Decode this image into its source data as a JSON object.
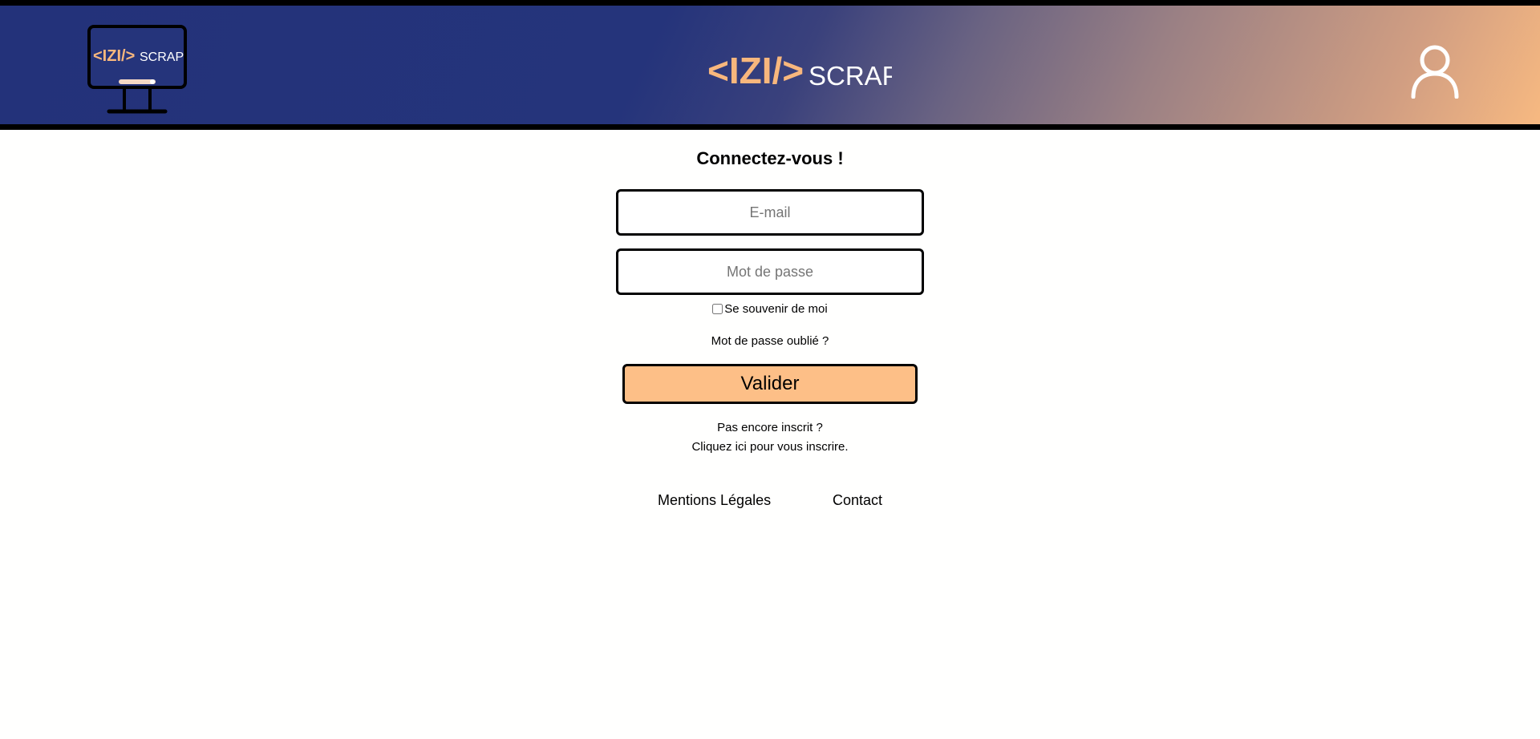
{
  "header": {
    "logo_small": {
      "brackets": "<IZI/>",
      "brand": "SCRAP"
    },
    "logo_center": {
      "brackets": "<IZI/>",
      "brand": "SCRAP"
    },
    "user_icon": "user-icon"
  },
  "login": {
    "title": "Connectez-vous !",
    "email_placeholder": "E-mail",
    "password_placeholder": "Mot de passe",
    "remember_label": "Se souvenir de moi",
    "remember_checked": false,
    "forgot_link": "Mot de passe oublié ?",
    "submit_label": "Valider",
    "signup_line1": "Pas encore inscrit ?",
    "signup_line2": "Cliquez ici pour vous inscrire."
  },
  "footer": {
    "legal": "Mentions Légales",
    "contact": "Contact"
  },
  "colors": {
    "header_start": "#23327a",
    "header_end": "#f7b981",
    "accent_orange": "#fdbf87",
    "logo_white": "#ffffff"
  }
}
